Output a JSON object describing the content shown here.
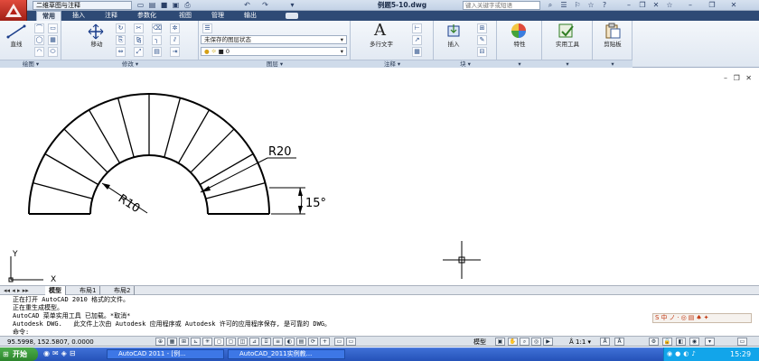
{
  "titlebar": {
    "workspace": "二维草图与注释",
    "doc_title": "例题5-10.dwg",
    "search_placeholder": "键入关键字或短语"
  },
  "tabs": [
    "常用",
    "插入",
    "注释",
    "参数化",
    "视图",
    "管理",
    "输出"
  ],
  "ribbon": {
    "draw": {
      "line_label": "直线",
      "panel": "绘图"
    },
    "modify": {
      "move_label": "移动",
      "panel": "修改"
    },
    "layers": {
      "state": "未保存的图层状态",
      "current": "0",
      "panel": "图层"
    },
    "annotation": {
      "mtext_label": "多行文字",
      "panel": "注释"
    },
    "block": {
      "insert_label": "插入",
      "panel": "块"
    },
    "properties_label": "特性",
    "utilities_label": "实用工具",
    "clipboard_label": "剪贴板"
  },
  "drawing": {
    "dim_r20": "R20",
    "dim_r10": "R10",
    "dim_angle": "15°",
    "ucs_x": "X",
    "ucs_y": "Y",
    "spoke_count": 12
  },
  "layout_tabs": [
    "模型",
    "布局1",
    "布局2"
  ],
  "command_lines": [
    "正在打开 AutoCAD 2010 格式的文件。",
    "正在重生成模型。",
    "AutoCAD 菜单实用工具 已加载。*取消*",
    "Autodesk DWG.   此文件上次由 Autodesk 应用程序或 Autodesk 许可的应用程序保存, 是可靠的 DWG。",
    "命令:"
  ],
  "status": {
    "coords": "95.5998, 152.5807, 0.0000",
    "model": "模型",
    "scale": "1:1"
  },
  "taskbar": {
    "start": "开始",
    "task1": "AutoCAD 2011 - [例...",
    "task2": "AutoCAD_2011实例教...",
    "clock": "15:29"
  },
  "ime": {
    "label": "中"
  },
  "colors": {
    "accent": "#2e4a75",
    "brand": "#c62e22",
    "taskbar": "#2552b8"
  }
}
